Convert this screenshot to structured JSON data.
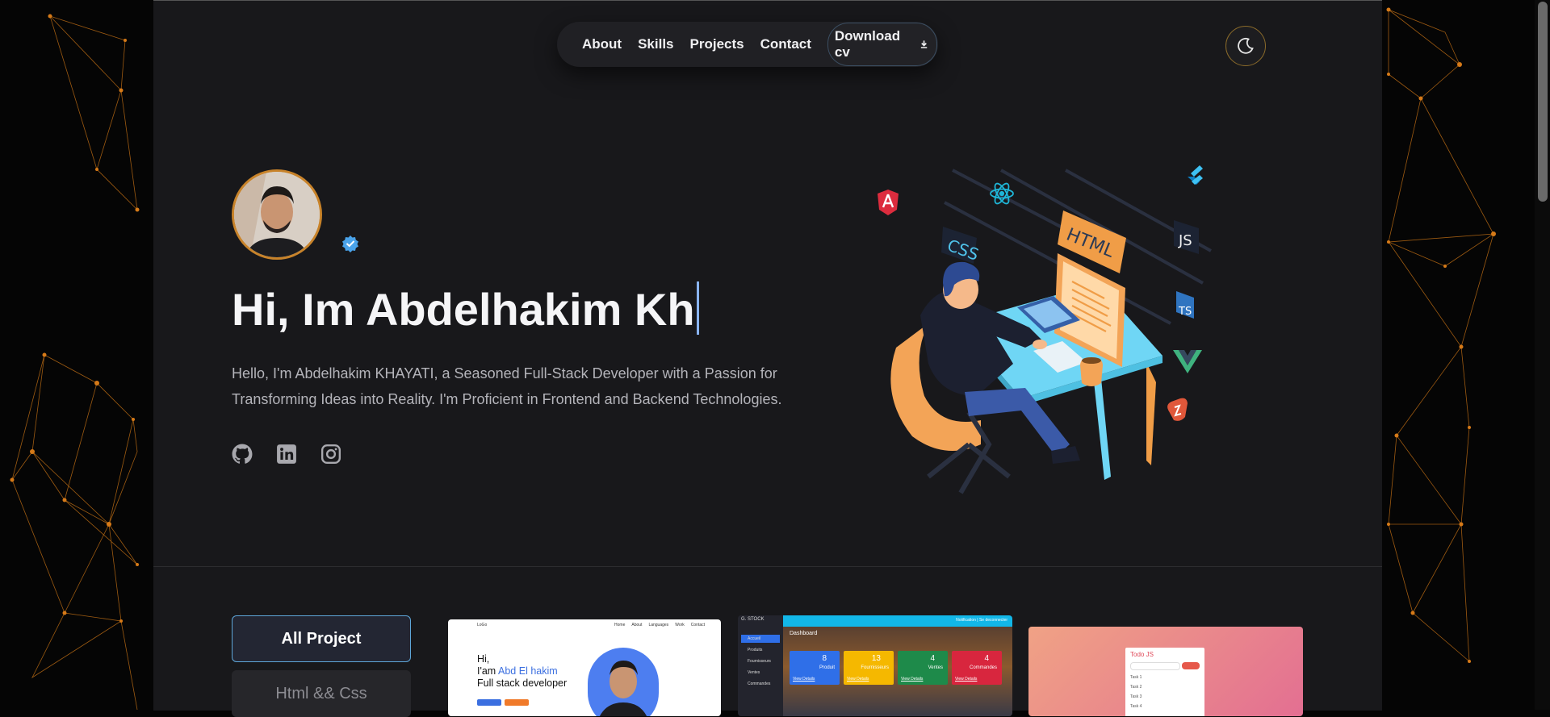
{
  "nav": {
    "links": [
      "About",
      "Skills",
      "Projects",
      "Contact"
    ],
    "download_label": "Download cv"
  },
  "hero": {
    "title_typed": "Hi, Im Abdelhakim Kh",
    "description": "Hello, I'm Abdelhakim KHAYATI, a Seasoned Full-Stack Developer with a Passion for Transforming Ideas into Reality. I'm Proficient in Frontend and Backend Technologies.",
    "socials": [
      "github-icon",
      "linkedin-icon",
      "instagram-icon"
    ],
    "illustration_labels": {
      "css": "CSS",
      "html": "HTML",
      "js": "JS",
      "ts": "TS"
    }
  },
  "projects": {
    "filters": [
      {
        "label": "All Project",
        "active": true
      },
      {
        "label": "Html && Css",
        "active": false
      }
    ],
    "card1": {
      "nav": [
        "LoGo",
        "Home",
        "About",
        "Languages",
        "Work",
        "Contact"
      ],
      "line1": "Hi,",
      "line2_prefix": "I'am ",
      "line2_name": "Abd El hakim",
      "line3": "Full stack developer"
    },
    "card2": {
      "brand": "G. STOCK",
      "menu": [
        "Accueil",
        "Produits",
        "Fournisseurs",
        "Ventes",
        "Commandes"
      ],
      "top_right": "Notification | Se deconnecter",
      "heading": "Dashboard",
      "tiles": [
        {
          "value": "8",
          "label": "Produit",
          "color": "#2f6fe8"
        },
        {
          "value": "13",
          "label": "Fournisseurs",
          "color": "#f5b800"
        },
        {
          "value": "4",
          "label": "Ventes",
          "color": "#1e8a4a"
        },
        {
          "value": "4",
          "label": "Commandes",
          "color": "#d8263e"
        }
      ],
      "view_details": "View Details"
    },
    "card3": {
      "title": "Todo JS",
      "items": [
        "Task 1",
        "Task 2",
        "Task 3",
        "Task 4"
      ]
    }
  },
  "colors": {
    "accent_orange": "#c8832a",
    "accent_blue": "#5ea6d9",
    "page_bg": "#18181b"
  }
}
